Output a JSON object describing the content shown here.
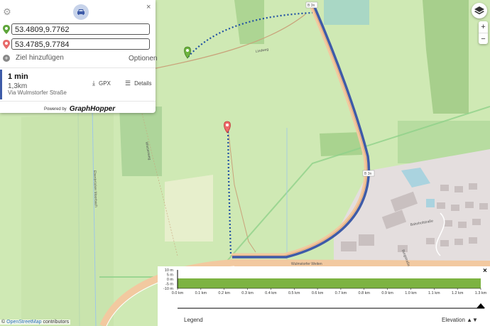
{
  "header": {
    "gear_icon": "gear-icon",
    "vehicle_icon": "car-icon",
    "close_label": "×"
  },
  "route_inputs": [
    {
      "value": "53.4809,9.7762",
      "pin_color": "#5ea53a"
    },
    {
      "value": "53.4785,9.7784",
      "pin_color": "#e86b6b"
    }
  ],
  "add_destination_label": "Ziel hinzufügen",
  "options_label": "Optionen",
  "route_summary": {
    "time": "1 min",
    "distance": "1,3km",
    "via": "Via Wulmstorfer Straße",
    "gpx_label": "GPX",
    "details_label": "Details"
  },
  "powered_by": {
    "label": "Powered by",
    "logo": "GraphHopper"
  },
  "map": {
    "zoom_in": "+",
    "zoom_out": "−",
    "street_labels": [
      "Lindweg",
      "B 3n",
      "B 3n",
      "Bahnhofstraße",
      "Wulmstorfer Weiten",
      "Burgstraße",
      "Ebenbrücker Moorbach",
      "Wiesenweg"
    ],
    "route_color": "#3e5ba8"
  },
  "elevation": {
    "y_ticks": [
      "10 m",
      "5 m",
      "0 m",
      "-5 m",
      "-10 m"
    ],
    "x_ticks": [
      "0.0 km",
      "0.1 km",
      "0.2 km",
      "0.3 km",
      "0.4 km",
      "0.5 km",
      "0.6 km",
      "0.7 km",
      "0.8 km",
      "0.9 km",
      "1.0 km",
      "1.1 km",
      "1.2 km",
      "1.3 km"
    ],
    "legend_label": "Legend",
    "elevation_label": "Elevation ▲▼",
    "close_label": "×",
    "fill_color": "#7db342"
  },
  "attribution": {
    "prefix": "©",
    "osm": "OpenStreetMap",
    "suffix": "contributors"
  }
}
